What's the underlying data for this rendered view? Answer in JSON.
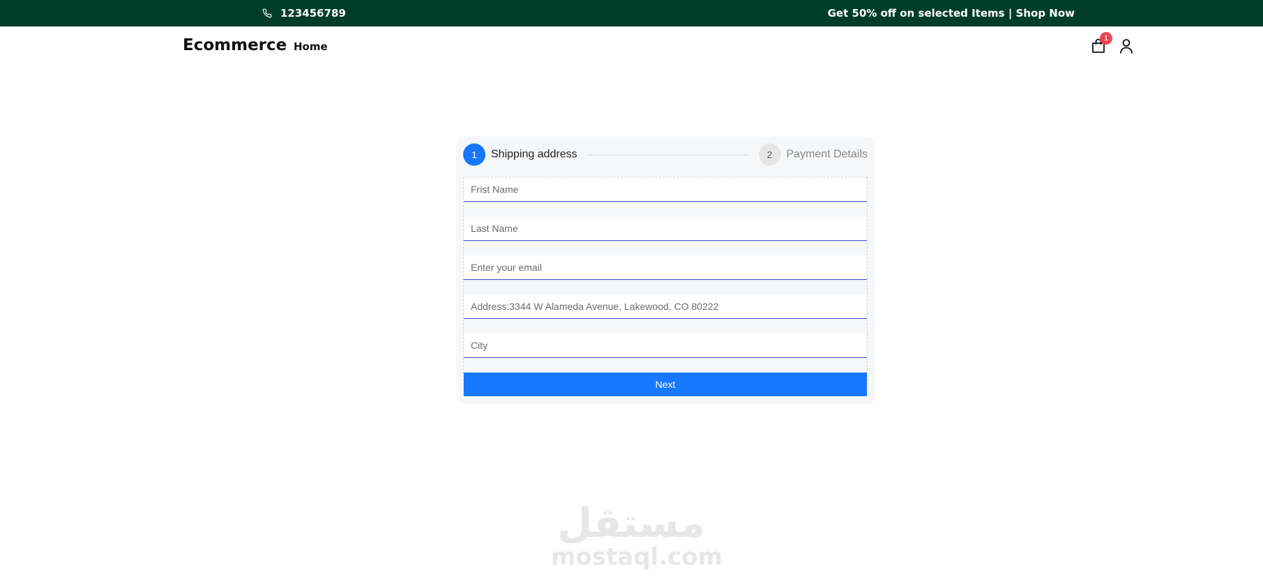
{
  "topbar": {
    "phone_icon": "phone-icon",
    "phone": "123456789",
    "promo": "Get 50% off on selected Items | Shop Now"
  },
  "header": {
    "logo": "Ecommerce",
    "nav": [
      {
        "label": "Home"
      }
    ],
    "cart": {
      "icon": "shopping-bag-icon",
      "badge_count": "1"
    },
    "user_icon": "user-icon"
  },
  "steps": [
    {
      "number": "1",
      "label": "Shipping address",
      "active": true
    },
    {
      "number": "2",
      "label": "Payment Details",
      "active": false
    }
  ],
  "form": {
    "first_name": {
      "placeholder": "Frist Name",
      "value": ""
    },
    "last_name": {
      "placeholder": "Last Name",
      "value": ""
    },
    "email": {
      "placeholder": "Enter your email",
      "value": ""
    },
    "address": {
      "placeholder": "Address:3344 W Alameda Avenue, Lakewood, CO 80222",
      "value": ""
    },
    "city": {
      "placeholder": "City",
      "value": ""
    },
    "next_label": "Next"
  },
  "watermark": {
    "arabic": "مستقل",
    "latin": "mostaql.com"
  },
  "colors": {
    "topbar_bg": "#003d29",
    "primary": "#1677ff",
    "badge": "#f04452",
    "input_underline": "#3949c8"
  }
}
